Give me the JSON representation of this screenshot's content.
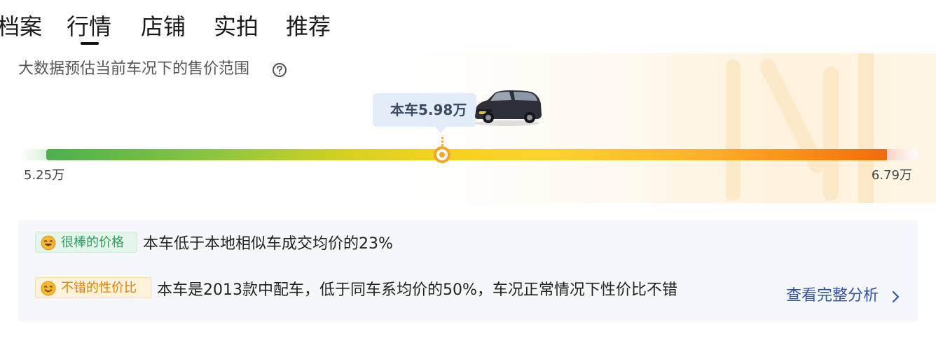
{
  "tabs": [
    {
      "label": "档案"
    },
    {
      "label": "行情",
      "active": true
    },
    {
      "label": "店铺"
    },
    {
      "label": "实拍"
    },
    {
      "label": "推荐"
    }
  ],
  "price_range": {
    "subtitle": "大数据预估当前车况下的售价范围",
    "help_icon": "question-circle-icon",
    "current_label": "本车5.98万",
    "min_label": "5.25万",
    "max_label": "6.79万",
    "min": 5.25,
    "max": 6.79,
    "current": 5.98,
    "bar_colors": [
      "#4caf50",
      "#f5d21c",
      "#f26a0a"
    ]
  },
  "evaluation": {
    "items": [
      {
        "tag": "很棒的价格",
        "icon": "grin-emoji-icon",
        "text": "本车低于本地相似车成交均价的23%"
      },
      {
        "tag": "不错的性价比",
        "icon": "smile-emoji-icon",
        "text": "本车是2013款中配车，低于同车系均价的50%，车况正常情况下性价比不错"
      }
    ],
    "link_label": "查看完整分析",
    "link_icon": "chevron-right-icon"
  }
}
